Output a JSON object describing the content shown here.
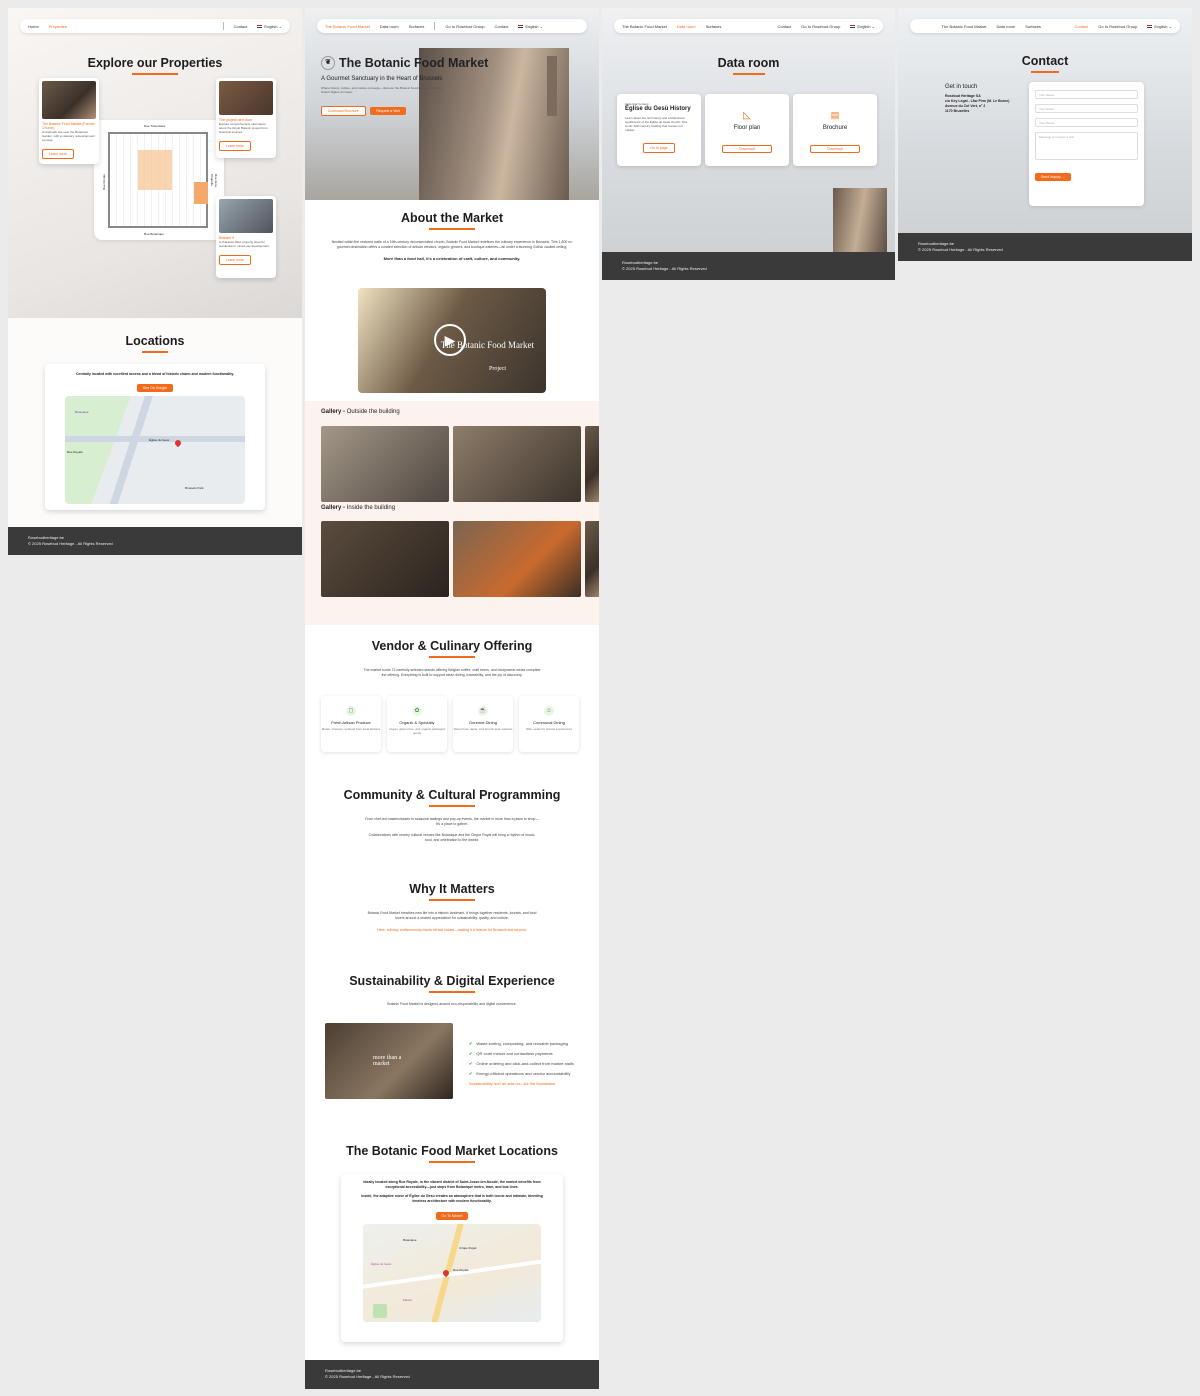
{
  "p1": {
    "nav": {
      "home": "Home",
      "properties": "Properties",
      "contact": "Contact",
      "lang": "English"
    },
    "title": "Explore our Properties",
    "cards": [
      {
        "title": "The Botanic Food Market (Former Church)",
        "desc": "A landmark site near the Botanical Garden, with a visionary redevelopment concept.",
        "btn": "Learn more"
      },
      {
        "title": "The project next door",
        "desc": "Explore comprehensive information about the Royal Botanic project from historical sources.",
        "btn": "Learn more"
      },
      {
        "title": "Brabant 5",
        "desc": "A character-filled property ideal for residential or mixed-use development.",
        "btn": "Learn more"
      }
    ],
    "streets": {
      "top": "Rue Traversière",
      "left": "Rue Royale",
      "right": "Rue de la Chapelle",
      "bottom": "Rue Botanique"
    },
    "locations_title": "Locations",
    "loc_text": "Centrally located with excellent access and a blend of historic charm and modern functionality.",
    "loc_btn": "See On Google",
    "map_labels": [
      "Botanique",
      "Église du Gesù",
      "Rue Royale",
      "Brussels Park"
    ],
    "footer": {
      "site": "Rosebudheritage.be",
      "copy": "© 2025 Rosebud Heritage - All Rights Reserved"
    }
  },
  "p2": {
    "nav": {
      "active": "The Botanic Food Market",
      "data": "Data room",
      "surfaces": "Surfaces",
      "group": "Go to Rosebud Group",
      "contact": "Contact",
      "lang": "English"
    },
    "hero_title": "The Botanic Food Market",
    "hero_sub": "A Gourmet Sanctuary in the Heart of Brussels",
    "hero_desc": "Where history, culture, and cuisine converge—discover the Botanic Food Market inside the historic Église du Gesù.",
    "hero_btn1": "Download Brochure",
    "hero_btn2": "Request a Visit",
    "about_title": "About the Market",
    "about_text": "Nestled within the restored walls of a 19th-century deconsecrated church, Botanic Food Market redefines the culinary experience in Brussels. This 1,800 m² gourmet destination offers a curated selection of artisan vendors, organic grocers, and boutique eateries—all under a stunning Gothic vaulted ceiling.",
    "about_bold": "More than a food hall, it's a celebration of craft, culture, and community.",
    "video_label": "The Botanic Food Market",
    "video_sub": "Project",
    "gallery_out": "Gallery -",
    "gallery_out2": "Outside the building",
    "gallery_in": "Gallery -",
    "gallery_in2": "Inside the building",
    "vendor_title": "Vendor & Culinary Offering",
    "vendor_text": "The market hosts 72 carefully selected stands offering Belgian coffee, craft beers, and biodynamic wines complete the offering. Everything is built to support clean dining, traceability, and the joy of discovery.",
    "vendors": [
      {
        "t": "Fresh Artisan Produce",
        "d": "Meats, cheeses, seafood from local artisans"
      },
      {
        "t": "Organic & Specialty",
        "d": "Vegan, gluten-free, and organic packaged goods"
      },
      {
        "t": "Gourmet Dining",
        "d": "Street food, tapas, and brunch style eateries"
      },
      {
        "t": "Communal Dining",
        "d": "300+ seats for shared experiences"
      }
    ],
    "community_title": "Community & Cultural Programming",
    "community_text1": "From chef-led masterclasses to seasonal tastings and pop-up events, the market is more than a place to shop—it's a place to gather.",
    "community_text2": "Collaborations with nearby cultural venues like Botanique and the Cirque Royal will bring a rhythm of music, food, and celebration to the district.",
    "why_title": "Why It Matters",
    "why_text": "Botanic Food Market breathes new life into a historic landmark. It brings together residents, tourists, and food lovers around a shared appreciation for sustainability, quality, and culture.",
    "why_orange": "Here, culinary craftsmanship meets ethical values—making it a beacon for Brussels and beyond.",
    "sus_title": "Sustainability & Digital Experience",
    "sus_text": "Botanic Food Market is designed around eco-responsibility and digital convenience.",
    "sus_img": "more than a market",
    "sus_list": [
      "Waste sorting, composting, and reusable packaging",
      "QR code menus and contactless payments",
      "Online ordering and click-and-collect from market stalls",
      "Energy-efficient operations and vendor accountability"
    ],
    "sus_orange": "Sustainability isn't an add-on—it's the foundation.",
    "loc_title": "The Botanic Food Market Locations",
    "loc_text1": "Ideally located along Rue Royale, in the vibrant district of Saint-Josse-ten-Noode, the market benefits from exceptional accessibility—just steps from Botanique metro, tram, and bus lines.",
    "loc_text2": "Inside, the adaptive reuse of Église du Gesù creates an atmosphere that is both iconic and intimate, blending timeless architecture with modern functionality.",
    "loc_btn": "Go To Market",
    "map_labels": [
      "Botanique",
      "Cirque Royal",
      "Rue Royale",
      "Église du Gesù",
      "Madou"
    ],
    "footer": {
      "site": "Rosebudheritage.be",
      "copy": "© 2025 Rosebud Heritage - All Rights Reserved"
    }
  },
  "p3": {
    "nav": {
      "bfm": "The Botanic Food Market",
      "data": "Data room",
      "surfaces": "Surfaces",
      "contact": "Contact",
      "group": "Go to Rosebud Group",
      "lang": "English"
    },
    "title": "Data room",
    "c1": {
      "eyebrow": "Historical Context",
      "title": "Église du Gesù History",
      "desc": "Learn about the rich history and architectural significance of the Église du Gesù church. This iconic 19th-century building that houses our market.",
      "btn": "Go to page"
    },
    "c2": {
      "title": "Floor plan",
      "btn": "Download"
    },
    "c3": {
      "title": "Brochure",
      "btn": "Download"
    },
    "footer": {
      "site": "Rosebudheritage.be",
      "copy": "© 2025 Rosebud Heritage - All Rights Reserved"
    }
  },
  "p4": {
    "nav": {
      "bfm": "The Botanic Food Market",
      "data": "Data room",
      "surfaces": "Surfaces",
      "contact": "Contact",
      "group": "Go to Rosebud Group",
      "lang": "English"
    },
    "title": "Contact",
    "get": "Get in touch",
    "address": [
      "Rosebud Heritage SA",
      "c/o Key Legal - Låw Firm (M. Le Borne)",
      "Avenue du Col Vert, n° 2",
      "1170 Bruxelles"
    ],
    "fields": [
      "Your Name",
      "Your Email",
      "Your Phone",
      "Message or request a visit"
    ],
    "btn": "Send Inquiry",
    "footer": {
      "site": "Rosebudheritage.be",
      "copy": "© 2025 Rosebud Heritage - All Rights Reserved"
    }
  }
}
